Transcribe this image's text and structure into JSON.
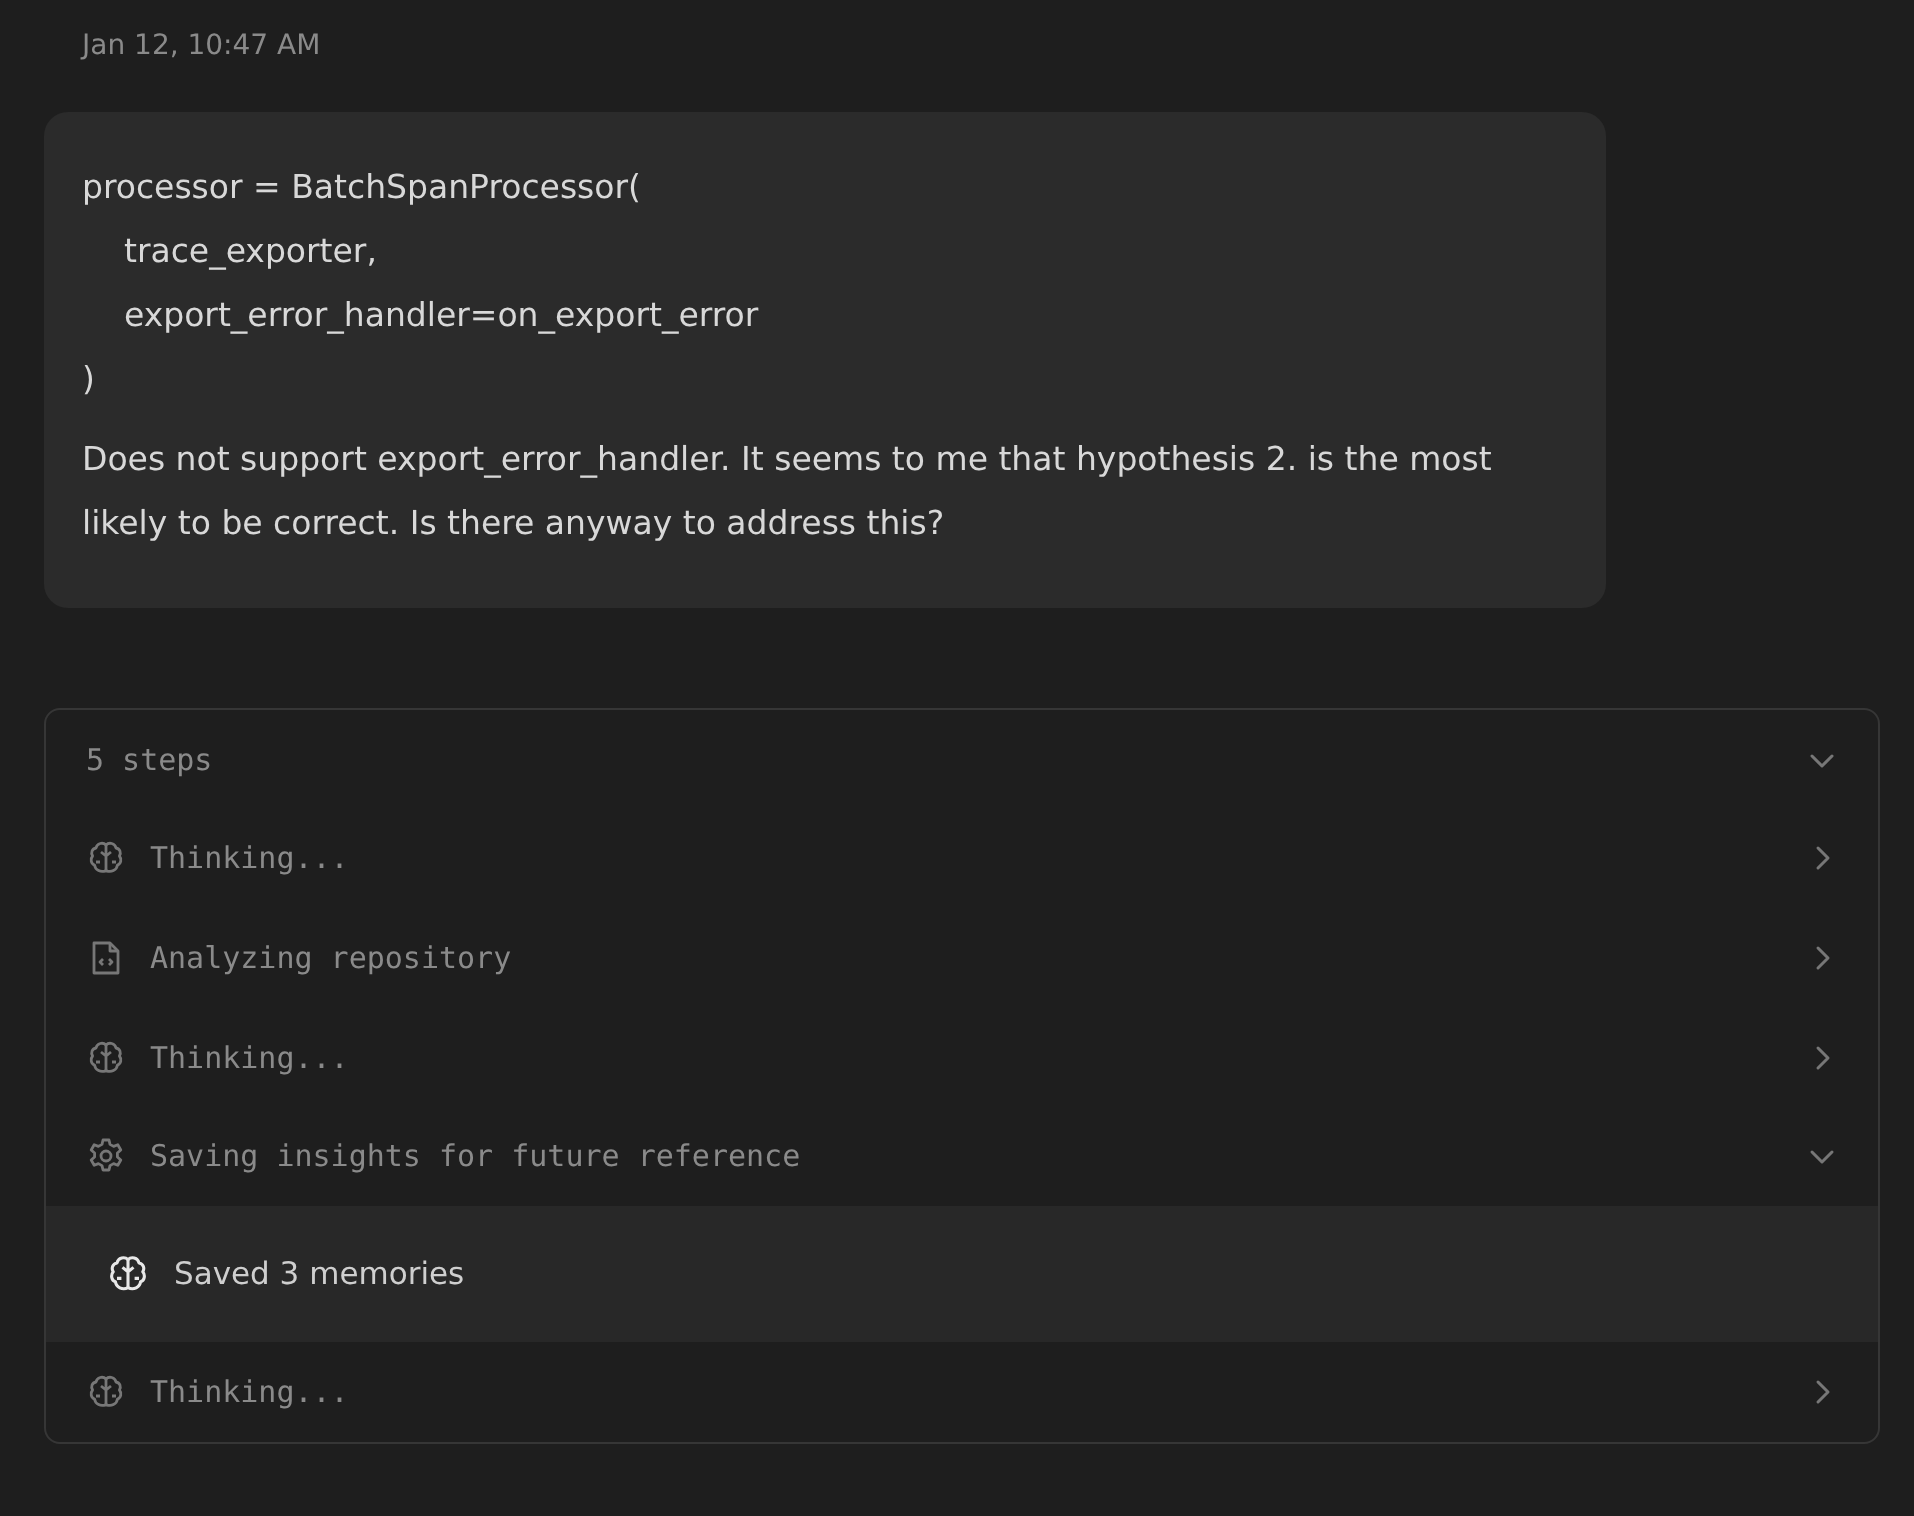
{
  "timestamp": "Jan 12, 10:47 AM",
  "message": {
    "code_lines": [
      "processor = BatchSpanProcessor(",
      "    trace_exporter,",
      "    export_error_handler=on_export_error",
      ")"
    ],
    "text": "Does not support export_error_handler. It seems to me that hypothesis 2. is the most likely to be correct. Is there anyway to address this?"
  },
  "steps": {
    "summary": "5 steps",
    "expanded": true,
    "items": [
      {
        "kind": "brain",
        "label": "Thinking...",
        "expanded": false
      },
      {
        "kind": "file",
        "label": "Analyzing repository",
        "expanded": false
      },
      {
        "kind": "brain",
        "label": "Thinking...",
        "expanded": false
      },
      {
        "kind": "gear",
        "label": "Saving insights for future reference",
        "expanded": true,
        "children": [
          {
            "label": "Saved 3 memories"
          }
        ]
      },
      {
        "kind": "brain",
        "label": "Thinking...",
        "expanded": false
      }
    ]
  }
}
